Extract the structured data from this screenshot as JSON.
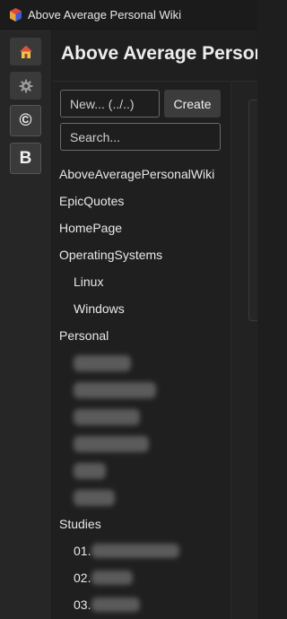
{
  "window": {
    "title": "Above Average Personal Wiki",
    "icon": "app-logo-icon"
  },
  "rail": {
    "buttons": [
      {
        "name": "home",
        "icon": "house-icon"
      },
      {
        "name": "settings",
        "icon": "gear-icon"
      },
      {
        "name": "copyright",
        "label": "©"
      },
      {
        "name": "bold",
        "label": "B"
      }
    ]
  },
  "header": {
    "title": "Above Average Personal Wiki"
  },
  "sidebar": {
    "new_page_placeholder": "New... (../..)",
    "create_label": "Create",
    "search_placeholder": "Search...",
    "tree": {
      "root_page": "AboveAveragePersonalWiki",
      "epic_quotes": "EpicQuotes",
      "home_page": "HomePage",
      "operating_systems": "OperatingSystems",
      "linux": "Linux",
      "windows": "Windows",
      "personal": "Personal",
      "studies": "Studies",
      "studies_children": [
        "01.",
        "02.",
        "03."
      ]
    }
  },
  "colors": {
    "background": "#1e1e1e",
    "rail_button": "#3a3a3a",
    "text": "#e8e8e8",
    "input_border": "#6a6a6a"
  }
}
